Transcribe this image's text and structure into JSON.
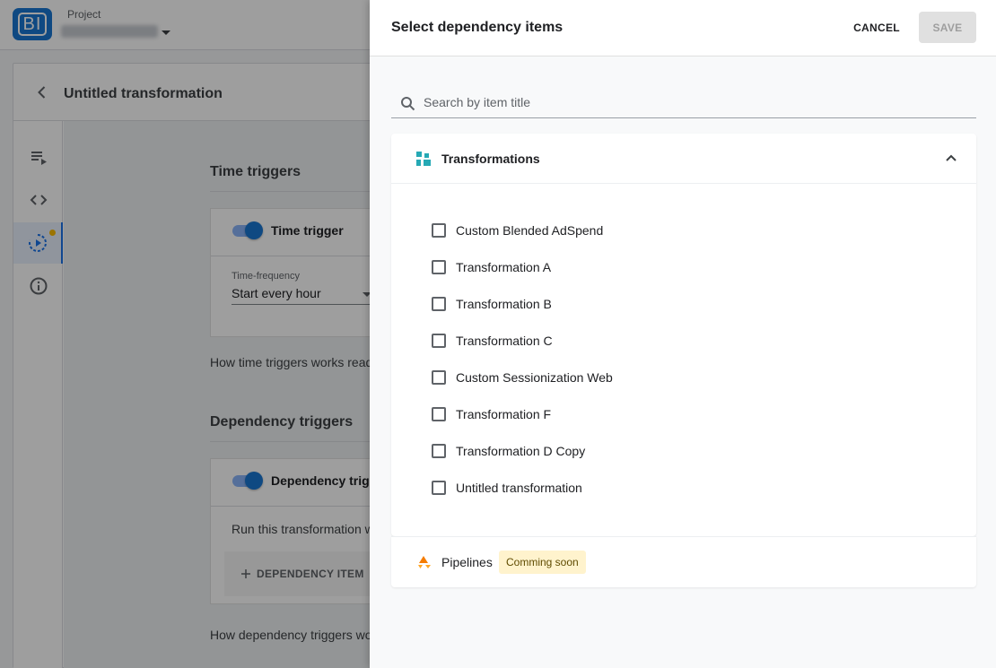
{
  "app": {
    "logo_text": "BI",
    "project_label": "Project",
    "title": "Untitled transformation"
  },
  "background": {
    "time_section_title": "Time triggers",
    "time_toggle_label": "Time trigger",
    "time_frequency_label": "Time-frequency",
    "time_frequency_value": "Start every hour",
    "time_help": "How time triggers works read",
    "dependency_section_title": "Dependency triggers",
    "dependency_toggle_label": "Dependency trigger",
    "dependency_text": "Run this transformation w",
    "dependency_button": "DEPENDENCY ITEM",
    "dependency_help": "How dependency triggers wo"
  },
  "drawer": {
    "title": "Select dependency items",
    "cancel_label": "CANCEL",
    "save_label": "SAVE",
    "search_placeholder": "Search by item title",
    "transformations_title": "Transformations",
    "items": [
      {
        "label": "Custom Blended AdSpend"
      },
      {
        "label": "Transformation A"
      },
      {
        "label": "Transformation B"
      },
      {
        "label": "Transformation C"
      },
      {
        "label": "Custom Sessionization Web"
      },
      {
        "label": "Transformation F"
      },
      {
        "label": "Transformation D Copy"
      },
      {
        "label": "Untitled transformation"
      }
    ],
    "pipelines_label": "Pipelines",
    "pipelines_badge": "Comming soon"
  },
  "colors": {
    "accent": "#1976d2",
    "transformations_icon": "#26a9b5",
    "pipelines_icon": "#f57c00",
    "badge_bg": "#fff3cd"
  }
}
